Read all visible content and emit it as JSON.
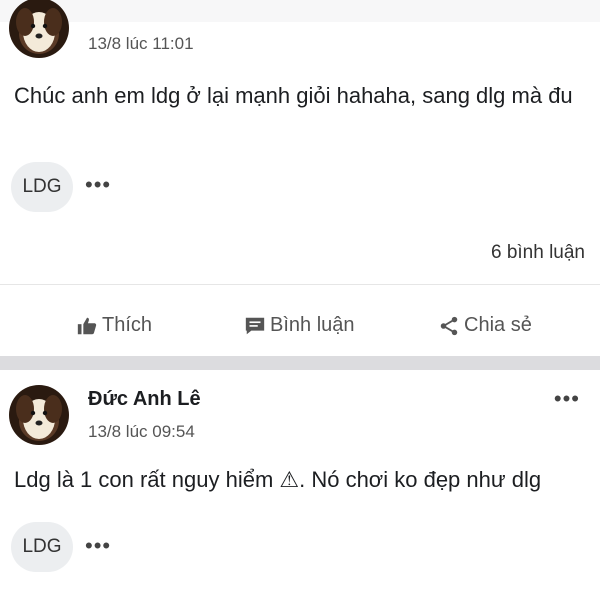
{
  "post1": {
    "time": "13/8 lúc 11:01",
    "text": "Chúc anh em ldg ở lại mạnh giỏi hahaha, sang dlg mà đu",
    "reaction_chip": "LDG",
    "more": "•••",
    "comment_count": "6 bình luận"
  },
  "actions": {
    "like": "Thích",
    "comment": "Bình luận",
    "share": "Chia sẻ"
  },
  "post2": {
    "author": "Đức Anh Lê",
    "time": "13/8 lúc 09:54",
    "menu": "•••",
    "text": "Ldg là 1 con rất nguy hiểm ⚠. Nó chơi ko đẹp như dlg",
    "reaction_chip": "LDG",
    "more": "•••"
  },
  "icons": {
    "like": "thumbs-up-icon",
    "comment": "comment-bubble-icon",
    "share": "share-icon"
  }
}
